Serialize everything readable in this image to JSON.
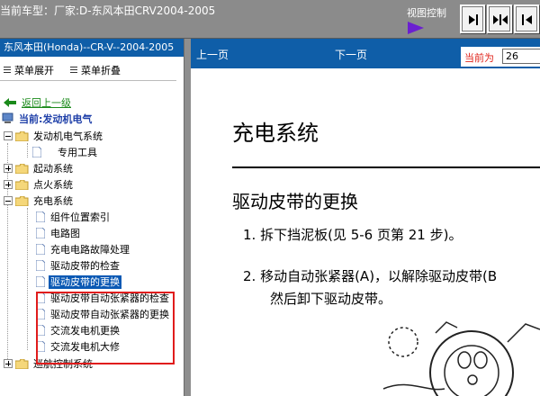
{
  "window": {
    "title": "当前车型：厂家:D-东风本田CRV2004-2005",
    "view_control_label": "视图控制",
    "view_buttons": [
      "collapse-left-icon",
      "split-view-icon",
      "expand-right-icon"
    ]
  },
  "left_panel": {
    "header": "东风本田(Honda)--CR-V--2004-2005",
    "menu_expand": "菜单展开",
    "menu_collapse": "菜单折叠",
    "back_link": "返回上一级",
    "current_label": "当前:发动机电气",
    "tree": [
      {
        "label": "发动机电气系统",
        "type": "folder",
        "expanded": true
      },
      {
        "label": "专用工具",
        "type": "doc"
      },
      {
        "label": "起动系统",
        "type": "folder",
        "expanded": false
      },
      {
        "label": "点火系统",
        "type": "folder",
        "expanded": false
      },
      {
        "label": "充电系统",
        "type": "folder",
        "expanded": true
      },
      {
        "label": "组件位置索引",
        "type": "doc"
      },
      {
        "label": "电路图",
        "type": "doc"
      },
      {
        "label": "充电电路故障处理",
        "type": "doc"
      },
      {
        "label": "驱动皮带的检查",
        "type": "doc"
      },
      {
        "label": "驱动皮带的更换",
        "type": "doc",
        "selected": true
      },
      {
        "label": "驱动皮带自动张紧器的检查",
        "type": "doc"
      },
      {
        "label": "驱动皮带自动张紧器的更换",
        "type": "doc"
      },
      {
        "label": "交流发电机更换",
        "type": "doc"
      },
      {
        "label": "交流发电机大修",
        "type": "doc"
      },
      {
        "label": "巡航控制系统",
        "type": "folder",
        "expanded": false
      }
    ]
  },
  "nav": {
    "prev": "上一页",
    "next": "下一页",
    "current_label": "当前为",
    "current_page": "26"
  },
  "doc": {
    "heading": "充电系统",
    "subheading": "驱动皮带的更换",
    "step1": "1.  拆下挡泥板(见 5-6 页第 21 步)。",
    "step2_line1": "2. 移动自动张紧器(A)，以解除驱动皮带(B",
    "step2_line2": "然后卸下驱动皮带。"
  },
  "colors": {
    "title_bar": "#8b8b8b",
    "header_blue": "#0f5ea8",
    "selection_blue": "#0a59b4",
    "highlight_red": "#e01c1c",
    "current_label_red": "#e0261d",
    "back_link_green": "#1a8a1a",
    "current_label_blue": "#1e3fa8"
  }
}
